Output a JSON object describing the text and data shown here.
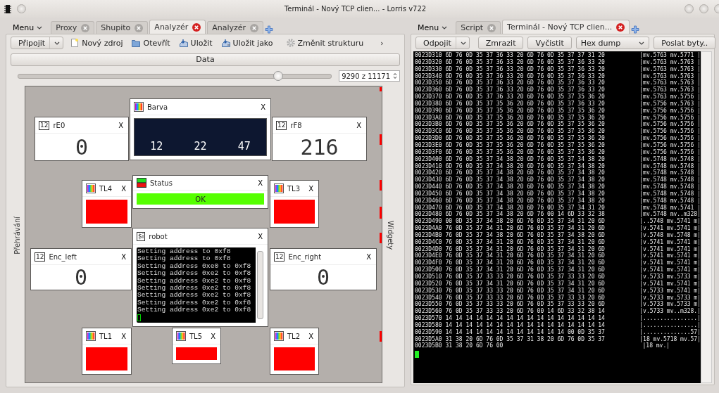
{
  "window": {
    "title": "Terminál - Nový TCP clien... - Lorris v722"
  },
  "left_pane": {
    "menu": "Menu",
    "tabs": [
      {
        "label": "Proxy",
        "selected": false
      },
      {
        "label": "Shupito",
        "selected": false
      },
      {
        "label": "Analyzér",
        "selected": true
      },
      {
        "label": "Analyzér",
        "selected": false
      }
    ],
    "connect_button": "Připojit",
    "toolbar": [
      {
        "kind": "new",
        "label": "Nový zdroj"
      },
      {
        "kind": "open",
        "label": "Otevřít"
      },
      {
        "kind": "save",
        "label": "Uložit"
      },
      {
        "kind": "save_as",
        "label": "Uložit jako"
      },
      {
        "kind": "settings",
        "label": "Změnit strukturu"
      }
    ],
    "overflow": "›",
    "data_bar": "Data",
    "slider": {
      "level": 0.83,
      "reading": "9290 z 11171"
    },
    "left_dock": "Přehrávání",
    "right_dock": "Widgety",
    "widgets": [
      {
        "kind": "color",
        "title": "Barva",
        "close": "X",
        "values": [
          "12",
          "22",
          "47"
        ]
      },
      {
        "kind": "number",
        "badge": "12",
        "title": "rE0",
        "close": "X",
        "value": "0"
      },
      {
        "kind": "number",
        "badge": "12",
        "title": "rF8",
        "close": "X",
        "value": "216"
      },
      {
        "kind": "light",
        "title": "TL4",
        "close": "X",
        "color": "#ff0000"
      },
      {
        "kind": "status",
        "title": "Status",
        "close": "X",
        "text": "OK",
        "color": "#55ff00"
      },
      {
        "kind": "light",
        "title": "TL3",
        "close": "X",
        "color": "#ff0000"
      },
      {
        "kind": "terminal",
        "badge": "$i",
        "title": "robot",
        "close": "X",
        "lines": [
          "Setting address to 0xf8",
          "Setting address to 0xf8",
          "Setting address 0xe0 to 0xf8",
          "Setting address 0xe2 to 0xf8",
          "Setting address 0xe2 to 0xf8",
          "Setting address 0xe2 to 0xf8",
          "Setting address 0xe2 to 0xf8",
          "Setting address 0xe2 to 0xf8",
          "Setting address 0xe2 to 0xf8"
        ]
      },
      {
        "kind": "number",
        "badge": "12",
        "title": "Enc_left",
        "close": "X",
        "value": "0"
      },
      {
        "kind": "number",
        "badge": "12",
        "title": "Enc_right",
        "close": "X",
        "value": "0"
      },
      {
        "kind": "light",
        "title": "TL1",
        "close": "X",
        "color": "#ff0000"
      },
      {
        "kind": "light",
        "title": "TL5",
        "close": "X",
        "color": "#ff0000"
      },
      {
        "kind": "light",
        "title": "TL2",
        "close": "X",
        "color": "#ff0000"
      }
    ]
  },
  "right_pane": {
    "menu": "Menu",
    "tabs": [
      {
        "label": "Script",
        "selected": false
      },
      {
        "label": "Terminál - Nový TCP clien...",
        "selected": true
      }
    ],
    "disconnect_button": "Odpojit",
    "freeze_button": "Zmrazit",
    "clear_button": "Vyčistit",
    "mode_select": "Hex dump",
    "send_button": "Poslat byty..",
    "hex_rows": [
      {
        "address": "0023D310",
        "bytes": "6D 76 0D 35 37 36 33 20 6D 76 0D 35 37 37 31 20",
        "ascii": "|mv.5763 mv.5771 |"
      },
      {
        "address": "0023D320",
        "bytes": "6D 76 0D 35 37 36 33 20 6D 76 0D 35 37 36 33 20",
        "ascii": "|mv.5763 mv.5763 |"
      },
      {
        "address": "0023D330",
        "bytes": "6D 76 0D 35 37 36 33 20 6D 76 0D 35 37 36 33 20",
        "ascii": "|mv.5763 mv.5763 |"
      },
      {
        "address": "0023D340",
        "bytes": "6D 76 0D 35 37 36 33 20 6D 76 0D 35 37 36 33 20",
        "ascii": "|mv.5763 mv.5763 |"
      },
      {
        "address": "0023D350",
        "bytes": "6D 76 0D 35 37 36 33 20 6D 76 0D 35 37 36 33 20",
        "ascii": "|mv.5763 mv.5763 |"
      },
      {
        "address": "0023D360",
        "bytes": "6D 76 0D 35 37 36 33 20 6D 76 0D 35 37 36 33 20",
        "ascii": "|mv.5763 mv.5763 |"
      },
      {
        "address": "0023D370",
        "bytes": "6D 76 0D 35 37 36 33 20 6D 76 0D 35 37 35 36 20",
        "ascii": "|mv.5763 mv.5756 |"
      },
      {
        "address": "0023D380",
        "bytes": "6D 76 0D 35 37 35 36 20 6D 76 0D 35 37 36 33 20",
        "ascii": "|mv.5756 mv.5763 |"
      },
      {
        "address": "0023D390",
        "bytes": "6D 76 0D 35 37 35 36 20 6D 76 0D 35 37 35 36 20",
        "ascii": "|mv.5756 mv.5756 |"
      },
      {
        "address": "0023D3A0",
        "bytes": "6D 76 0D 35 37 35 36 20 6D 76 0D 35 37 35 36 20",
        "ascii": "|mv.5756 mv.5756 |"
      },
      {
        "address": "0023D3B0",
        "bytes": "6D 76 0D 35 37 35 36 20 6D 76 0D 35 37 35 36 20",
        "ascii": "|mv.5756 mv.5756 |"
      },
      {
        "address": "0023D3C0",
        "bytes": "6D 76 0D 35 37 35 36 20 6D 76 0D 35 37 35 36 20",
        "ascii": "|mv.5756 mv.5756 |"
      },
      {
        "address": "0023D3D0",
        "bytes": "6D 76 0D 35 37 35 36 20 6D 76 0D 35 37 35 36 20",
        "ascii": "|mv.5756 mv.5756 |"
      },
      {
        "address": "0023D3E0",
        "bytes": "6D 76 0D 35 37 35 36 20 6D 76 0D 35 37 35 36 20",
        "ascii": "|mv.5756 mv.5756 |"
      },
      {
        "address": "0023D3F0",
        "bytes": "6D 76 0D 35 37 35 36 20 6D 76 0D 35 37 35 36 20",
        "ascii": "|mv.5756 mv.5756 |"
      },
      {
        "address": "0023D400",
        "bytes": "6D 76 0D 35 37 34 38 20 6D 76 0D 35 37 34 38 20",
        "ascii": "|mv.5748 mv.5748 |"
      },
      {
        "address": "0023D410",
        "bytes": "6D 76 0D 35 37 34 38 20 6D 76 0D 35 37 34 38 20",
        "ascii": "|mv.5748 mv.5748 |"
      },
      {
        "address": "0023D420",
        "bytes": "6D 76 0D 35 37 34 38 20 6D 76 0D 35 37 34 38 20",
        "ascii": "|mv.5748 mv.5748 |"
      },
      {
        "address": "0023D430",
        "bytes": "6D 76 0D 35 37 34 38 20 6D 76 0D 35 37 34 38 20",
        "ascii": "|mv.5748 mv.5748 |"
      },
      {
        "address": "0023D440",
        "bytes": "6D 76 0D 35 37 34 38 20 6D 76 0D 35 37 34 38 20",
        "ascii": "|mv.5748 mv.5748 |"
      },
      {
        "address": "0023D450",
        "bytes": "6D 76 0D 35 37 34 38 20 6D 76 0D 35 37 34 38 20",
        "ascii": "|mv.5748 mv.5748 |"
      },
      {
        "address": "0023D460",
        "bytes": "6D 76 0D 35 37 34 38 20 6D 76 0D 35 37 34 38 20",
        "ascii": "|mv.5748 mv.5748 |"
      },
      {
        "address": "0023D470",
        "bytes": "6D 76 0D 35 37 34 38 20 6D 76 0D 35 37 34 31 20",
        "ascii": "|mv.5748 mv.5741 |"
      },
      {
        "address": "0023D480",
        "bytes": "6D 76 0D 35 37 34 38 20 6D 76 00 14 6D 33 32 38",
        "ascii": "|mv.5748 mv..m328|"
      },
      {
        "address": "0023D490",
        "bytes": "00 0D 35 37 34 38 20 6D 76 0D 35 37 34 31 20 6D",
        "ascii": "|..5748 mv.5741 m|"
      },
      {
        "address": "0023D4A0",
        "bytes": "76 0D 35 37 34 31 20 6D 76 0D 35 37 34 31 20 6D",
        "ascii": "|v.5741 mv.5741 m|"
      },
      {
        "address": "0023D4B0",
        "bytes": "76 0D 35 37 34 38 20 6D 76 0D 35 37 34 38 20 6D",
        "ascii": "|v.5748 mv.5748 m|"
      },
      {
        "address": "0023D4C0",
        "bytes": "76 0D 35 37 34 31 20 6D 76 0D 35 37 34 31 20 6D",
        "ascii": "|v.5741 mv.5741 m|"
      },
      {
        "address": "0023D4D0",
        "bytes": "76 0D 35 37 34 31 20 6D 76 0D 35 37 34 31 20 6D",
        "ascii": "|v.5741 mv.5741 m|"
      },
      {
        "address": "0023D4E0",
        "bytes": "76 0D 35 37 34 31 20 6D 76 0D 35 37 34 31 20 6D",
        "ascii": "|v.5741 mv.5741 m|"
      },
      {
        "address": "0023D4F0",
        "bytes": "76 0D 35 37 34 31 20 6D 76 0D 35 37 34 31 20 6D",
        "ascii": "|v.5741 mv.5741 m|"
      },
      {
        "address": "0023D500",
        "bytes": "76 0D 35 37 34 31 20 6D 76 0D 35 37 34 31 20 6D",
        "ascii": "|v.5741 mv.5741 m|"
      },
      {
        "address": "0023D510",
        "bytes": "76 0D 35 37 33 33 20 6D 76 0D 35 37 33 33 20 6D",
        "ascii": "|v.5733 mv.5733 m|"
      },
      {
        "address": "0023D520",
        "bytes": "76 0D 35 37 34 31 20 6D 76 0D 35 37 34 31 20 6D",
        "ascii": "|v.5741 mv.5741 m|"
      },
      {
        "address": "0023D530",
        "bytes": "76 0D 35 37 33 33 20 6D 76 0D 35 37 34 31 20 6D",
        "ascii": "|v.5733 mv.5741 m|"
      },
      {
        "address": "0023D540",
        "bytes": "76 0D 35 37 33 33 20 6D 76 0D 35 37 33 33 20 6D",
        "ascii": "|v.5733 mv.5733 m|"
      },
      {
        "address": "0023D550",
        "bytes": "76 0D 35 37 33 33 20 6D 76 0D 35 37 33 33 20 6D",
        "ascii": "|v.5733 mv.5733 m|"
      },
      {
        "address": "0023D560",
        "bytes": "76 0D 35 37 33 33 20 6D 76 00 14 6D 33 32 38 14",
        "ascii": "|v.5733 mv..m328.|"
      },
      {
        "address": "0023D570",
        "bytes": "14 14 14 14 14 14 14 14 14 14 14 14 14 14 14 14",
        "ascii": "|................|"
      },
      {
        "address": "0023D580",
        "bytes": "14 14 14 14 14 14 14 14 14 14 14 14 14 14 14 14",
        "ascii": "|................|"
      },
      {
        "address": "0023D590",
        "bytes": "14 14 14 14 14 14 14 14 14 14 14 14 00 0D 35 37",
        "ascii": "|..............57|"
      },
      {
        "address": "0023D5A0",
        "bytes": "31 38 20 6D 76 0D 35 37 31 38 20 6D 76 0D 35 37",
        "ascii": "|18 mv.5718 mv.57|"
      },
      {
        "address": "0023D5B0",
        "bytes": "31 38 20 6D 76 00",
        "ascii": "|18 mv.|"
      }
    ]
  }
}
